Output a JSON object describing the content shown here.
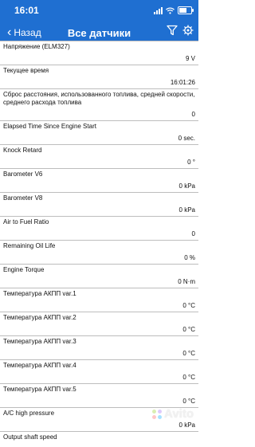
{
  "status_bar": {
    "time": "16:01"
  },
  "nav": {
    "back_label": "Назад",
    "title": "Все датчики"
  },
  "sensors": [
    {
      "label": "Напряжение (ELM327)",
      "value": "9 V"
    },
    {
      "label": "Текущее время",
      "value": "16:01:26"
    },
    {
      "label": "Сброс расстояния, использованного топлива, средней скорости, среднего расхода топлива",
      "value": "0"
    },
    {
      "label": "Elapsed Time Since Engine Start",
      "value": "0 sec."
    },
    {
      "label": "Knock Retard",
      "value": "0 °"
    },
    {
      "label": "Barometer V6",
      "value": "0 kPa"
    },
    {
      "label": "Barometer V8",
      "value": "0 kPa"
    },
    {
      "label": "Air to Fuel Ratio",
      "value": "0"
    },
    {
      "label": "Remaining Oil Life",
      "value": "0 %"
    },
    {
      "label": "Engine Torque",
      "value": "0 N·m"
    },
    {
      "label": "Температура АКПП var.1",
      "value": "0 °C"
    },
    {
      "label": "Температура АКПП var.2",
      "value": "0 °C"
    },
    {
      "label": "Температура АКПП var.3",
      "value": "0 °C"
    },
    {
      "label": "Температура АКПП var.4",
      "value": "0 °C"
    },
    {
      "label": "Температура АКПП var.5",
      "value": "0 °C"
    },
    {
      "label": "A/C high pressure",
      "value": "0 kPa"
    },
    {
      "label": "Output shaft speed",
      "value": ""
    }
  ],
  "watermark": {
    "text": "Avito"
  },
  "colors": {
    "topbar": "#1f6fd1"
  }
}
